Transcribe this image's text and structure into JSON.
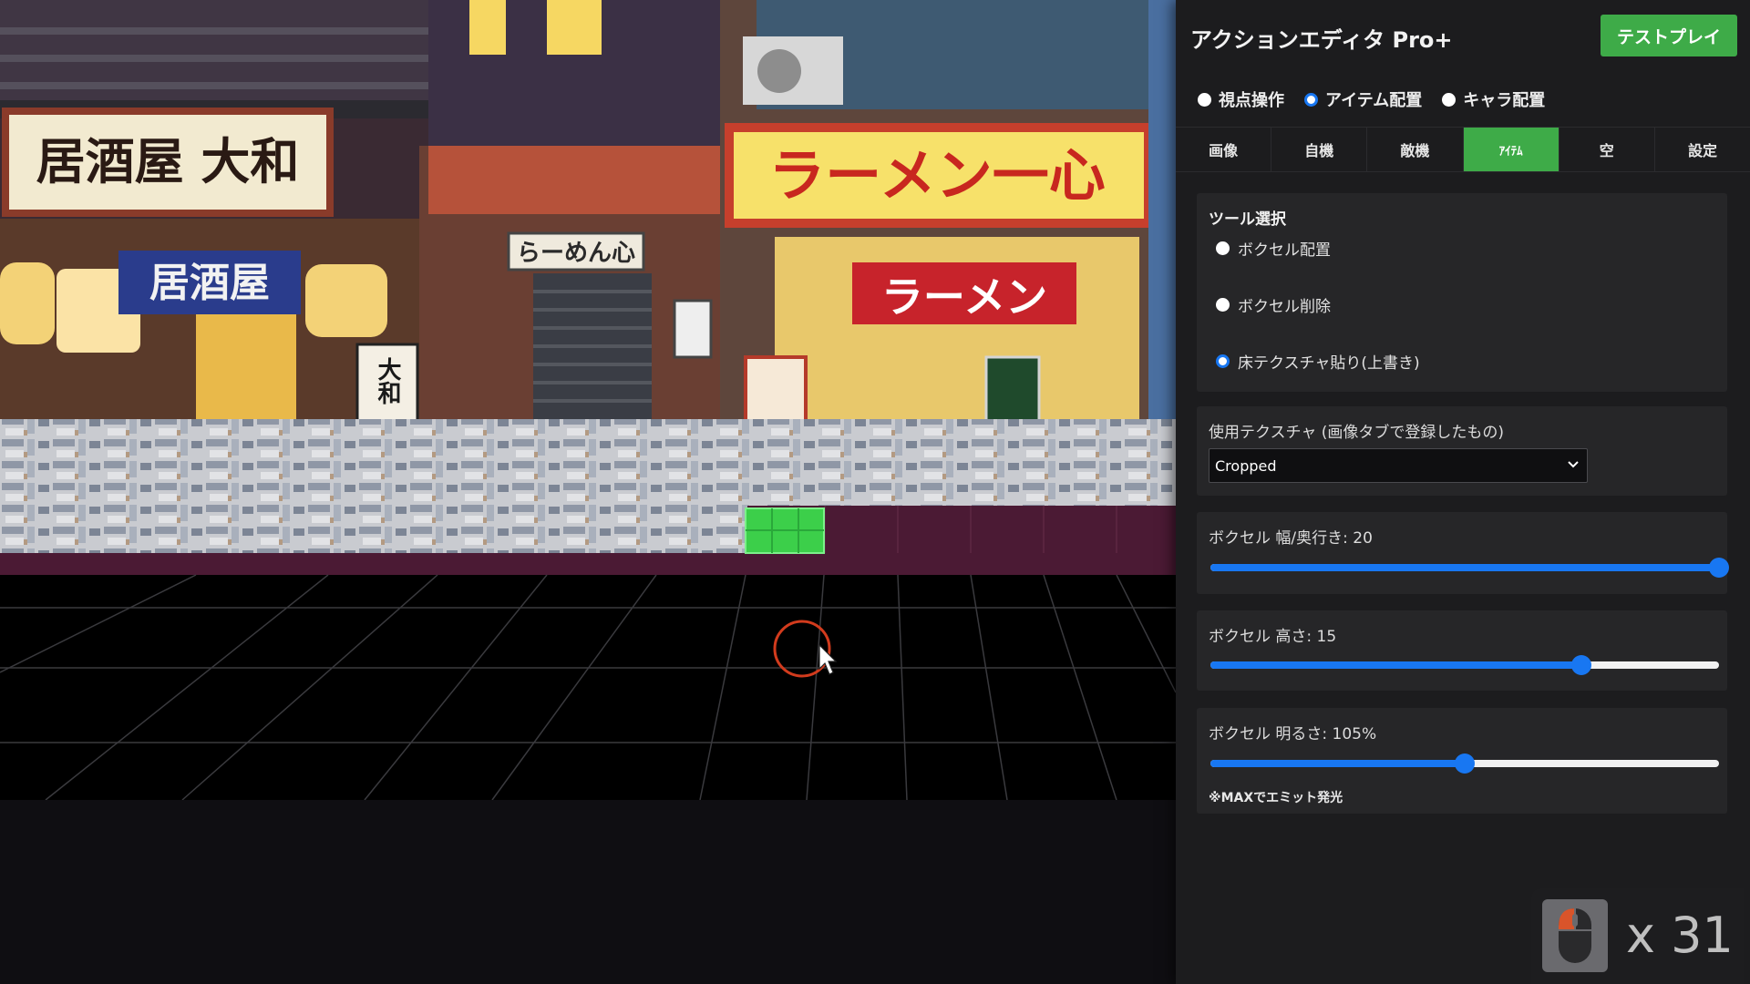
{
  "app": {
    "title": "アクションエディタ Pro+",
    "test_play_label": "テストプレイ"
  },
  "modes": [
    {
      "label": "視点操作",
      "selected": false
    },
    {
      "label": "アイテム配置",
      "selected": true
    },
    {
      "label": "キャラ配置",
      "selected": false
    }
  ],
  "tabs": [
    {
      "label": "画像",
      "active": false
    },
    {
      "label": "自機",
      "active": false
    },
    {
      "label": "敵機",
      "active": false
    },
    {
      "label": "ｱｲﾃﾑ",
      "active": true
    },
    {
      "label": "空",
      "active": false
    },
    {
      "label": "設定",
      "active": false
    }
  ],
  "tool_select": {
    "title": "ツール選択",
    "options": [
      {
        "label": "ボクセル配置",
        "selected": false
      },
      {
        "label": "ボクセル削除",
        "selected": false
      },
      {
        "label": "床テクスチャ貼り(上書き)",
        "selected": true
      }
    ]
  },
  "texture": {
    "label": "使用テクスチャ (画像タブで登録したもの)",
    "selected_value": "Cropped"
  },
  "sliders": {
    "width_depth": {
      "label": "ボクセル 幅/奥行き: 20",
      "value": 20,
      "fraction": 1.0
    },
    "height": {
      "label": "ボクセル 高さ: 15",
      "value": 15,
      "fraction": 0.73
    },
    "brightness": {
      "label": "ボクセル 明るさ: 105%",
      "value": 105,
      "fraction": 0.5
    }
  },
  "brightness_note": "※MAXでエミット発光",
  "click_counter": {
    "text": "x 31",
    "icon": "mouse-icon"
  },
  "viewport": {
    "signs": {
      "izakaya_yamato": "居酒屋 大和",
      "izakaya": "居酒屋",
      "yamato": "大和",
      "ramen_shop_small": "らーめん心",
      "ramen_isshin": "ラーメン一心",
      "ramen_banner": "ラーメン"
    }
  },
  "colors": {
    "accent_green": "#3eab48",
    "accent_blue": "#1877f2",
    "cursor_ring": "#d23b1d",
    "placed_voxel": "#3ccf4a"
  }
}
